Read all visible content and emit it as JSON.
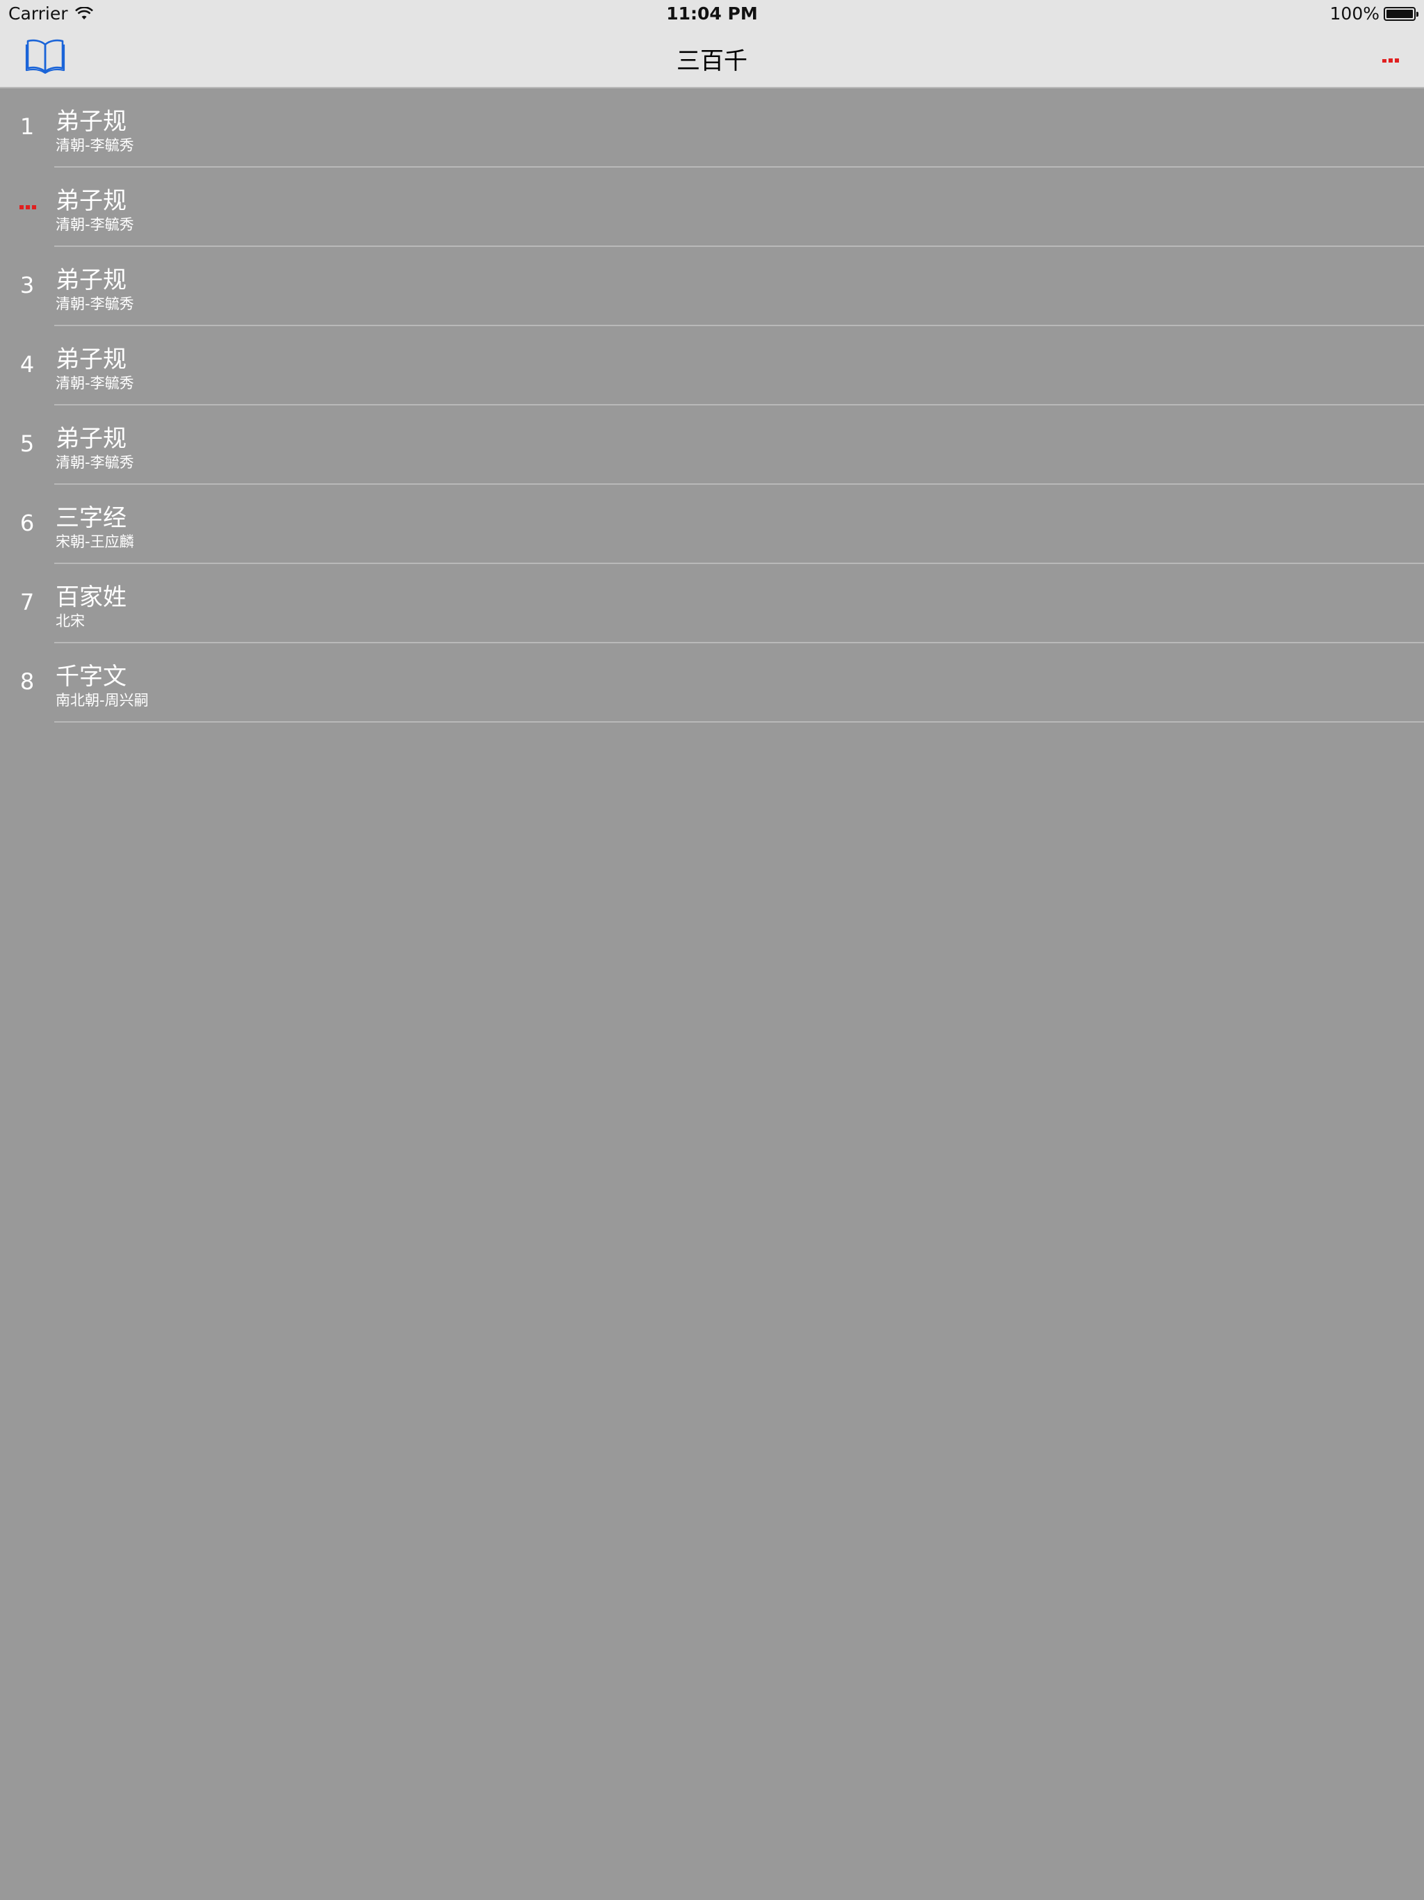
{
  "status_bar": {
    "carrier": "Carrier",
    "time": "11:04 PM",
    "battery": "100%",
    "battery_level": 1.0
  },
  "nav": {
    "title": "三百千",
    "left_icon": "book-open-icon",
    "right_icon": "more-dots-icon"
  },
  "colors": {
    "bar_background": "#e4e4e4",
    "list_background": "#999999",
    "accent_blue": "#1a64d8",
    "dots_red": "#e02020",
    "text_white": "#ffffff"
  },
  "rows": [
    {
      "index": "1",
      "title": "弟子规",
      "author": "清朝-李毓秀"
    },
    {
      "index": "",
      "title": "弟子规",
      "author": "清朝-李毓秀",
      "index_icon": "loading-dots-icon"
    },
    {
      "index": "3",
      "title": "弟子规",
      "author": "清朝-李毓秀"
    },
    {
      "index": "4",
      "title": "弟子规",
      "author": "清朝-李毓秀"
    },
    {
      "index": "5",
      "title": "弟子规",
      "author": "清朝-李毓秀"
    },
    {
      "index": "6",
      "title": "三字经",
      "author": "宋朝-王应麟"
    },
    {
      "index": "7",
      "title": "百家姓",
      "author": "北宋"
    },
    {
      "index": "8",
      "title": "千字文",
      "author": "南北朝-周兴嗣"
    }
  ]
}
